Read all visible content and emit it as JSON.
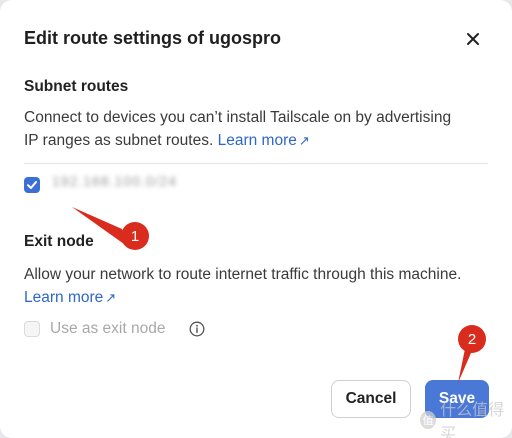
{
  "dialog": {
    "title": "Edit route settings of ugospro",
    "close_icon": "close-icon"
  },
  "subnet": {
    "heading": "Subnet routes",
    "description": "Connect to devices you can’t install Tailscale on by advertising IP ranges as subnet routes. ",
    "learn_more": "Learn more",
    "route_label": "192.168.100.0/24",
    "route_checked": true
  },
  "exit_node": {
    "heading": "Exit node",
    "description": "Allow your network to route internet traffic through this machine. ",
    "learn_more": "Learn more",
    "checkbox_label": "Use as exit node",
    "checkbox_checked": false,
    "checkbox_disabled": true,
    "info_icon": "info-icon"
  },
  "buttons": {
    "cancel": "Cancel",
    "save": "Save"
  },
  "annotations": {
    "marker_1": "1",
    "marker_2": "2"
  },
  "watermark": {
    "logo": "值",
    "text": "什么值得买"
  },
  "colors": {
    "accent": "#3c6fd6",
    "save_button": "#4a78d6",
    "link": "#2f66c9",
    "annotation": "#d92b1e"
  }
}
